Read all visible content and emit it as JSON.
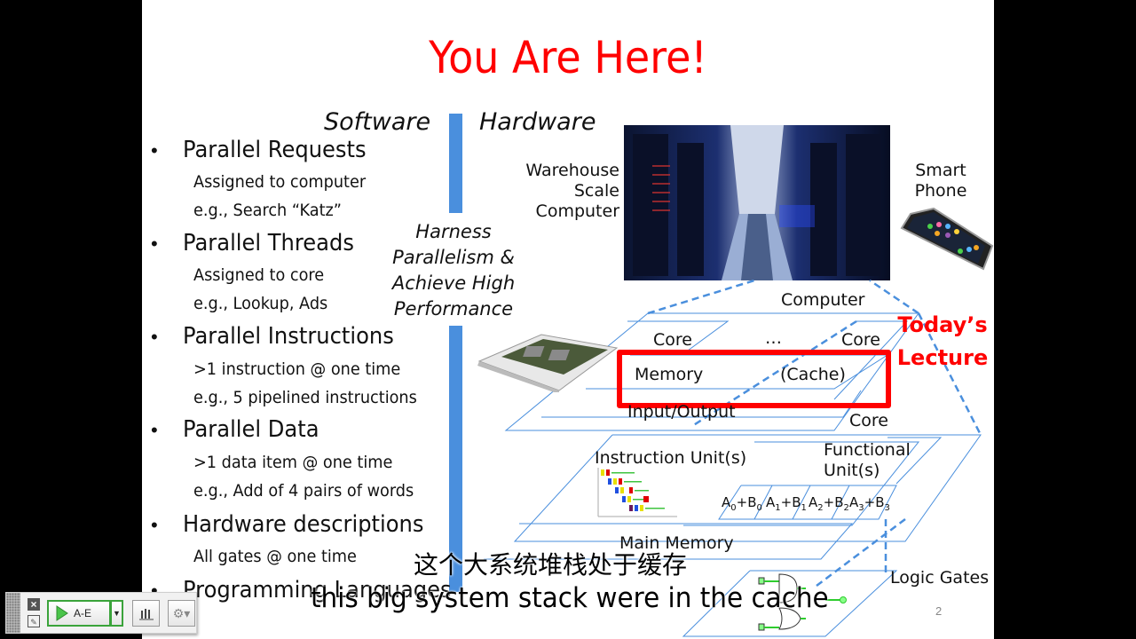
{
  "slide": {
    "title": "You Are Here!",
    "software_header": "Software",
    "hardware_header": "Hardware",
    "harness_lines": [
      "Harness",
      "Parallelism &",
      "Achieve High",
      "Performance"
    ],
    "bullets": [
      {
        "label": "Parallel Requests",
        "sub": [
          "Assigned to computer",
          "e.g., Search “Katz”"
        ]
      },
      {
        "label": "Parallel Threads",
        "sub": [
          "Assigned to core",
          "e.g., Lookup, Ads"
        ]
      },
      {
        "label": "Parallel Instructions",
        "sub": [
          ">1 instruction @ one time",
          "e.g., 5 pipelined instructions"
        ]
      },
      {
        "label": "Parallel Data",
        "sub": [
          ">1 data item @ one time",
          "e.g., Add of 4 pairs of words"
        ]
      },
      {
        "label": "Hardware descriptions",
        "sub": [
          "All gates @ one time"
        ]
      },
      {
        "label": "Programming Languages",
        "sub": []
      }
    ],
    "bullet_glyph": "•",
    "page_number": "2"
  },
  "diagram": {
    "warehouse_lines": [
      "Warehouse",
      "Scale",
      "Computer"
    ],
    "smartphone_lines": [
      "Smart",
      "Phone"
    ],
    "computer": "Computer",
    "core_left": "Core",
    "ellipsis": "…",
    "core_right": "Core",
    "memory": "Memory",
    "cache": "(Cache)",
    "io": "Input/Output",
    "core_lower": "Core",
    "instruction_units": "Instruction Unit(s)",
    "functional_units_lines": [
      "Functional",
      "Unit(s)"
    ],
    "adders": [
      {
        "a": "A",
        "ai": "0",
        "b": "B",
        "bi": "0"
      },
      {
        "a": "A",
        "ai": "1",
        "b": "B",
        "bi": "1"
      },
      {
        "a": "A",
        "ai": "2",
        "b": "B",
        "bi": "2"
      },
      {
        "a": "A",
        "ai": "3",
        "b": "B",
        "bi": "3"
      }
    ],
    "main_memory": "Main Memory",
    "logic_gates": "Logic Gates",
    "todays_lecture_lines": [
      "Today’s",
      "Lecture"
    ],
    "highlight_color": "#ff0000",
    "line_color": "#4a8fdd"
  },
  "subtitles": {
    "chinese": "这个大系统堆栈处于缓存",
    "english": "this big system stack were in the cache"
  },
  "toolbar": {
    "start_label": "A-E",
    "icons": [
      "close-icon",
      "edit-icon",
      "play-icon",
      "dropdown-arrow-icon",
      "bar-chart-icon",
      "gear-icon"
    ]
  }
}
